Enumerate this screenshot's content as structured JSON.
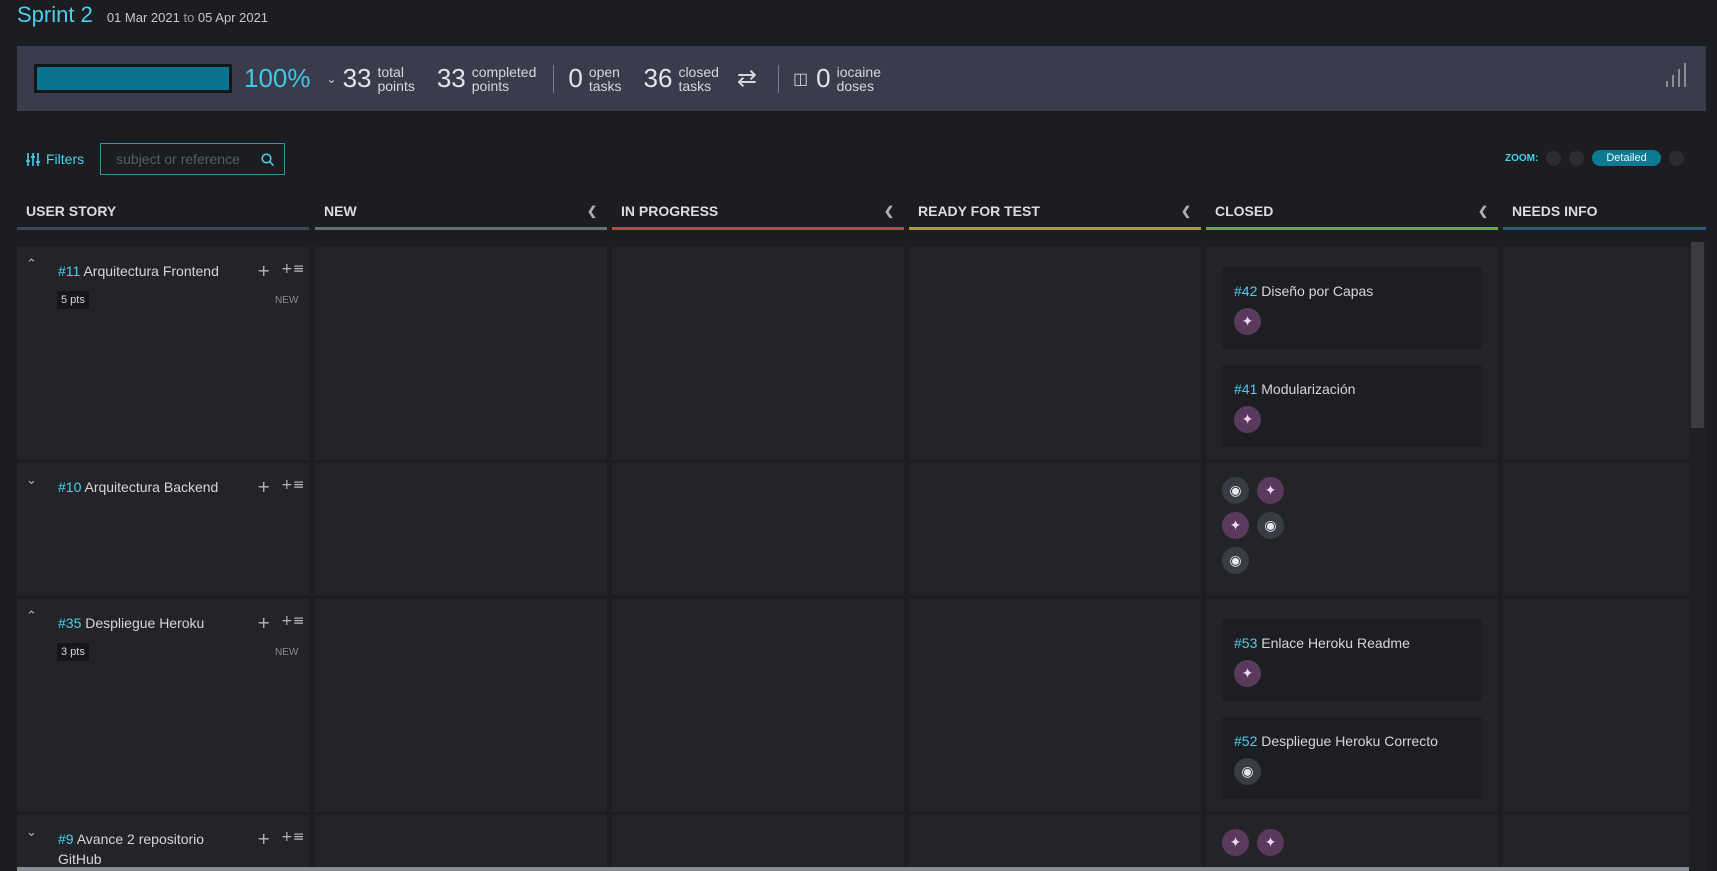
{
  "sprint": {
    "title": "Sprint 2",
    "date_start": "01 Mar 2021",
    "date_to": "to",
    "date_end": "05 Apr 2021"
  },
  "summary": {
    "progress": 1.0,
    "percent": "100%",
    "total_points": {
      "num": "33",
      "l1": "total",
      "l2": "points"
    },
    "completed_points": {
      "num": "33",
      "l1": "completed",
      "l2": "points"
    },
    "open_tasks": {
      "num": "0",
      "l1": "open",
      "l2": "tasks"
    },
    "closed_tasks": {
      "num": "36",
      "l1": "closed",
      "l2": "tasks"
    },
    "iocaine": {
      "num": "0",
      "l1": "iocaine",
      "l2": "doses"
    }
  },
  "filters": {
    "label": "Filters",
    "search_placeholder": "subject or reference"
  },
  "zoom": {
    "label": "ZOOM:",
    "active": "Detailed"
  },
  "columns": [
    {
      "label": "USER STORY",
      "color": "#3a4a5e"
    },
    {
      "label": "NEW",
      "color": "#6a6e72"
    },
    {
      "label": "IN PROGRESS",
      "color": "#b8501e"
    },
    {
      "label": "READY FOR TEST",
      "color": "#a8a020"
    },
    {
      "label": "CLOSED",
      "color": "#6ea82e"
    },
    {
      "label": "NEEDS INFO",
      "color": "#2e54a8"
    }
  ],
  "stories": [
    {
      "ref": "#11",
      "title": "Arquitectura Frontend",
      "points": "5 pts",
      "status": "NEW",
      "tasks": [
        {
          "ref": "#42",
          "title": "Diseño por Capas",
          "avatar": "wolf"
        },
        {
          "ref": "#41",
          "title": "Modularización",
          "avatar": "wolf"
        }
      ]
    },
    {
      "ref": "#10",
      "title": "Arquitectura Backend"
    },
    {
      "ref": "#35",
      "title": "Despliegue Heroku",
      "points": "3 pts",
      "status": "NEW",
      "tasks": [
        {
          "ref": "#53",
          "title": "Enlace Heroku Readme",
          "avatar": "wolf"
        },
        {
          "ref": "#52",
          "title": "Despliegue Heroku Correcto",
          "avatar": "bear"
        }
      ]
    },
    {
      "ref": "#9",
      "title": "Avance 2 repositorio GitHub"
    }
  ],
  "icons": {
    "collapse_up": "chevron-up-icon",
    "collapse_down": "chevron-down-icon",
    "add": "plus-icon",
    "add_list": "add-list-icon"
  }
}
